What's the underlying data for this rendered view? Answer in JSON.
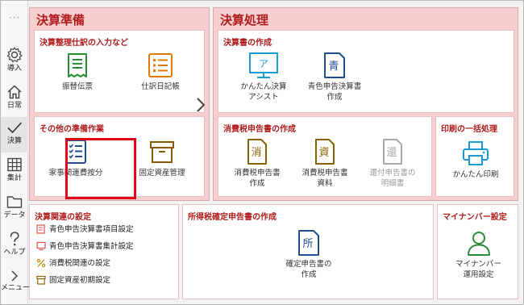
{
  "nav": {
    "dots": "···",
    "items": [
      {
        "label": "導入"
      },
      {
        "label": "日常"
      },
      {
        "label": "決算"
      },
      {
        "label": "集計"
      },
      {
        "label": "データ"
      },
      {
        "label": "ヘルプ"
      },
      {
        "label": "メニュー"
      }
    ]
  },
  "prep": {
    "title": "決算準備",
    "entry_box": {
      "title": "決算整理仕訳の入力など",
      "tiles": [
        {
          "label": "振替伝票"
        },
        {
          "label": "仕訳日記帳"
        }
      ]
    },
    "other_box": {
      "title": "その他の準備作業",
      "tiles": [
        {
          "label": "家事関連費按分"
        },
        {
          "label": "固定資産管理"
        }
      ]
    }
  },
  "process": {
    "title": "決算処理",
    "docs_box": {
      "title": "決算書の作成",
      "tiles": [
        {
          "label_line1": "かんたん決算",
          "label_line2": "アシスト",
          "icon_glyph": "ア"
        },
        {
          "label_line1": "青色申告決算書",
          "label_line2": "作成",
          "icon_glyph": "青"
        }
      ]
    },
    "tax_box": {
      "title": "消費税申告書の作成",
      "tiles": [
        {
          "label_line1": "消費税申告書",
          "label_line2": "作成",
          "icon_glyph": "消"
        },
        {
          "label_line1": "消費税申告書",
          "label_line2": "資料",
          "icon_glyph": "資"
        },
        {
          "label_line1": "還付申告書の",
          "label_line2": "明細書",
          "icon_glyph": "還"
        }
      ]
    },
    "print_box": {
      "title": "印刷の一括処理",
      "tiles": [
        {
          "label": "かんたん印刷"
        }
      ]
    }
  },
  "settings": {
    "title": "決算関連の設定",
    "items": [
      {
        "label": "青色申告決算書項目設定"
      },
      {
        "label": "青色申告決算書集計設定"
      },
      {
        "label": "消費税関連の設定"
      },
      {
        "label": "固定資産初期設定"
      }
    ]
  },
  "income_tax": {
    "title": "所得税確定申告書の作成",
    "tile": {
      "label_line1": "確定申告書の",
      "label_line2": "作成",
      "icon_glyph": "所"
    }
  },
  "mynumber": {
    "title": "マイナンバー設定",
    "tile": {
      "label_line1": "マイナンバー",
      "label_line2": "運用設定"
    }
  },
  "colors": {
    "accent": "#b01c1c",
    "panel_bg": "#f7cfcf",
    "icon_green": "#2e8b3a",
    "icon_orange": "#e07b00",
    "icon_blue": "#1f4f8f",
    "icon_teal": "#1a9bd7",
    "highlight": "#e0001a"
  }
}
